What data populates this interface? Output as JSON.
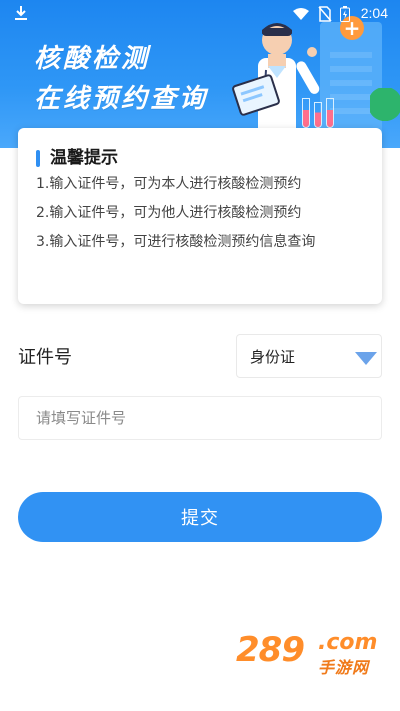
{
  "status_bar": {
    "time": "2:04",
    "icons": [
      "download-icon",
      "wifi-icon",
      "no-sim-icon",
      "battery-icon"
    ]
  },
  "banner": {
    "title_line1": "核酸检测",
    "title_line2": "在线预约查询",
    "colors": {
      "start": "#1d86f0",
      "end": "#4aa8fb"
    }
  },
  "notice": {
    "title": "温馨提示",
    "tips": [
      "1.输入证件号，可为本人进行核酸检测预约",
      "2.输入证件号，可为他人进行核酸检测预约",
      "3.输入证件号，可进行核酸检测预约信息查询"
    ]
  },
  "form": {
    "id_label": "证件号",
    "id_type_selected": "身份证",
    "id_input_placeholder": "请填写证件号",
    "id_input_value": "",
    "submit_label": "提交"
  },
  "watermark": {
    "number": "289",
    "domain": ".com",
    "site_name": "手游网"
  },
  "colors": {
    "accent": "#3192f3",
    "watermark": "#ff8d2a"
  }
}
